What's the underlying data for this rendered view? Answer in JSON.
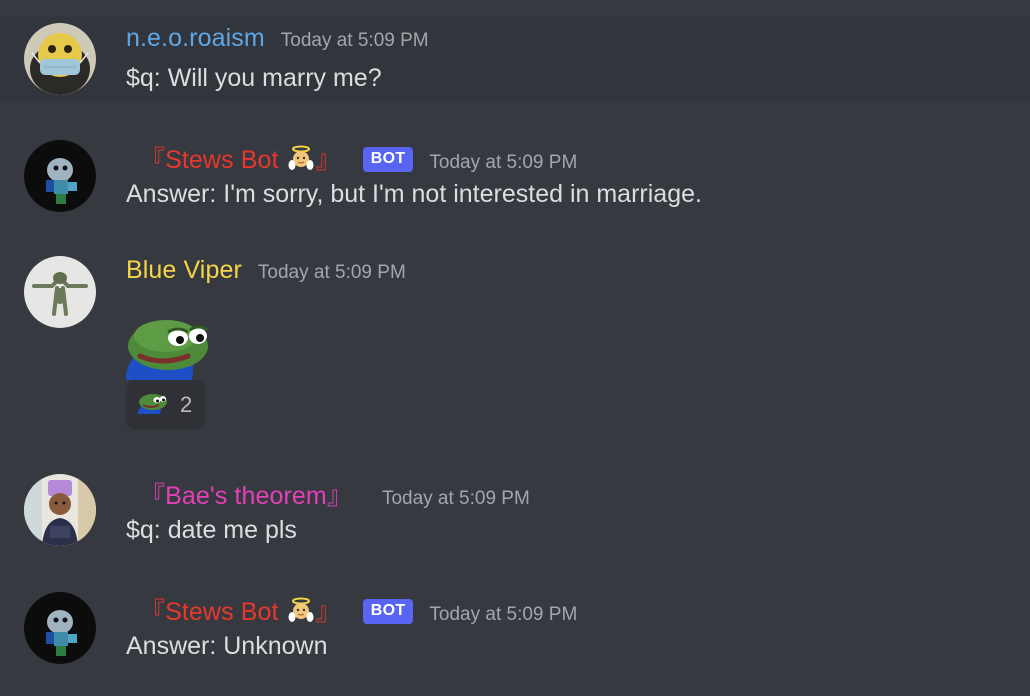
{
  "messages": [
    {
      "username": "n.e.o.roaism",
      "timestamp": "Today at 5:09 PM",
      "content": "$q: Will you marry me?",
      "color": "#5ea7e6"
    },
    {
      "username_left": "『",
      "username": "Stews Bot",
      "username_emoji": "baby-angel-emoji",
      "username_right": "』",
      "bot_tag": "BOT",
      "timestamp": "Today at 5:09 PM",
      "content": "Answer:  I'm sorry, but I'm not interested in marriage.",
      "color": "#e8372c"
    },
    {
      "username": "Blue Viper",
      "timestamp": "Today at 5:09 PM",
      "content_emoji": "pepe-emoji",
      "reaction": {
        "emoji": "pepe-emoji",
        "count": "2"
      },
      "color": "#f5d547"
    },
    {
      "username_left": "『",
      "username": "Bae's theorem",
      "username_right": "』",
      "timestamp": "Today at 5:09 PM",
      "content": "$q: date me pls",
      "color": "#e540b9"
    },
    {
      "username_left": "『",
      "username": "Stews Bot",
      "username_emoji": "baby-angel-emoji",
      "username_right": "』",
      "bot_tag": "BOT",
      "timestamp": "Today at 5:09 PM",
      "content": "Answer:  Unknown",
      "color": "#e8372c"
    }
  ],
  "colors": {
    "background": "#36393f",
    "highlight": "#32353b",
    "bot_tag": "#5865f2",
    "text": "#dcddde",
    "timestamp": "#a3a6aa"
  }
}
